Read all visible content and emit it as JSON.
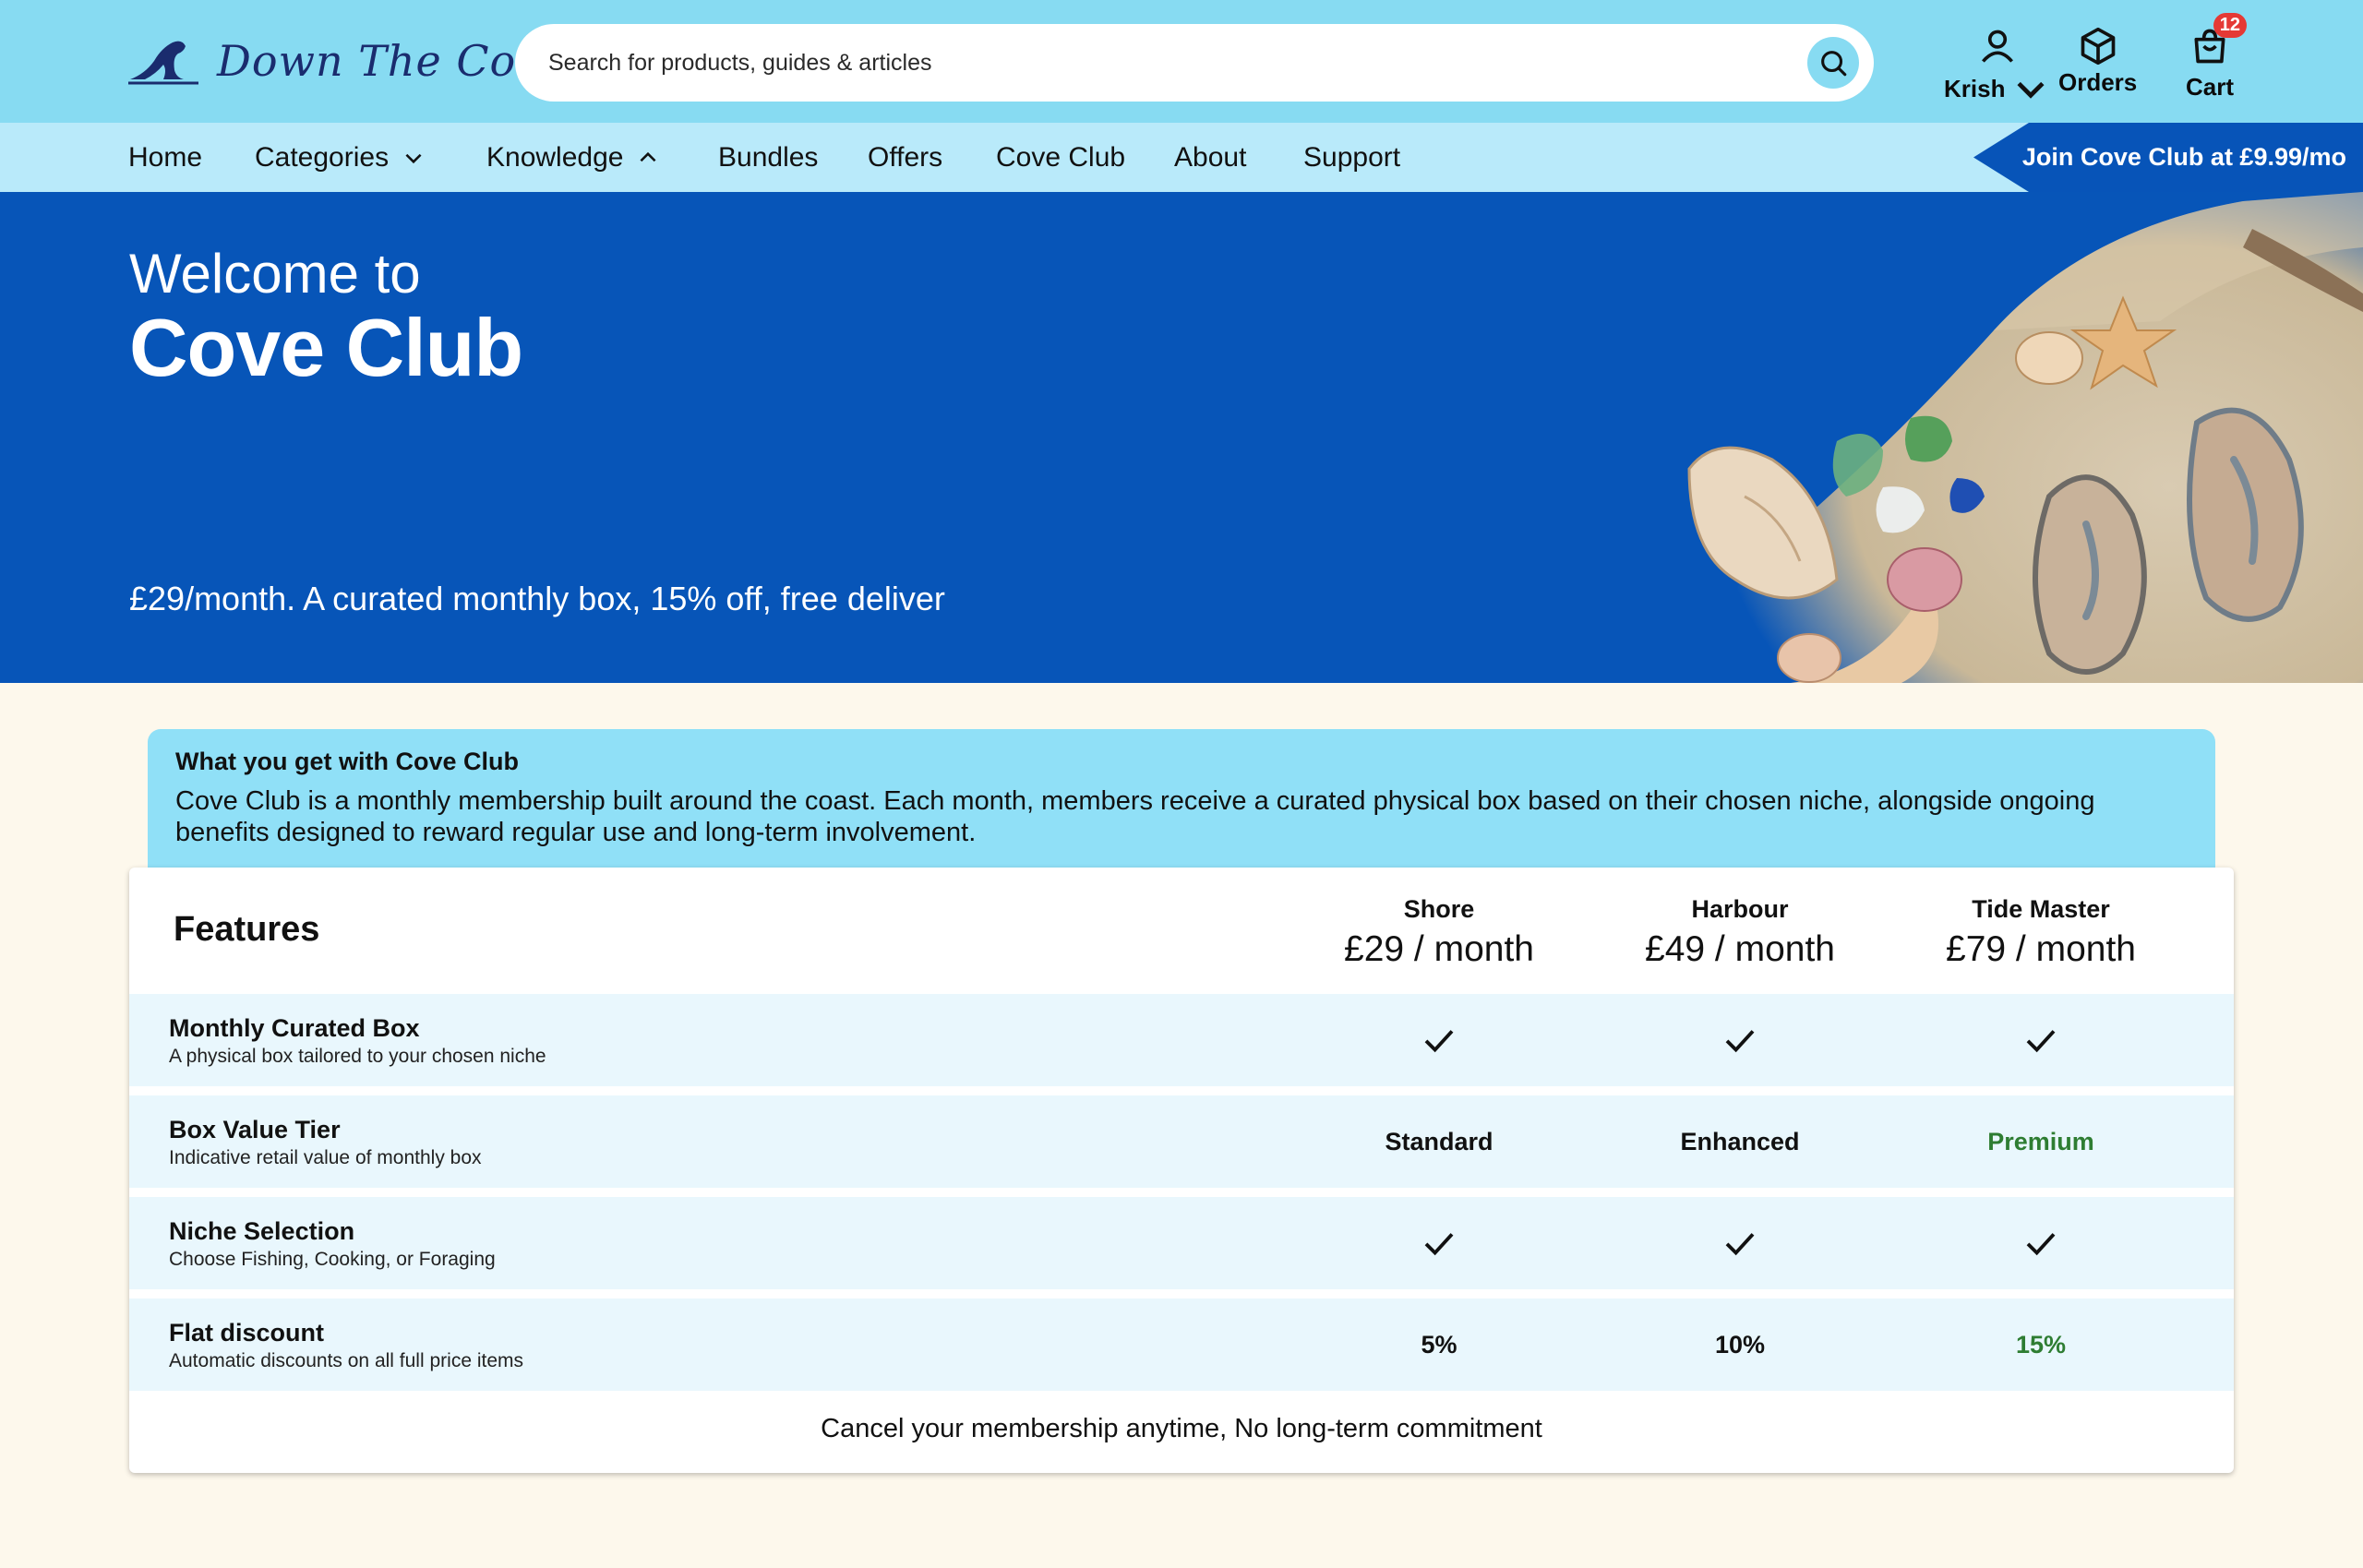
{
  "brand": {
    "name": "Down The Cove"
  },
  "search": {
    "placeholder": "Search for products, guides & articles"
  },
  "header": {
    "account_label": "Krish",
    "orders_label": "Orders",
    "cart_label": "Cart",
    "cart_count": "12"
  },
  "nav": {
    "items": [
      {
        "label": "Home"
      },
      {
        "label": "Categories"
      },
      {
        "label": "Knowledge"
      },
      {
        "label": "Bundles"
      },
      {
        "label": "Offers"
      },
      {
        "label": "Cove Club"
      },
      {
        "label": "About"
      },
      {
        "label": "Support"
      }
    ],
    "join_banner": "Join Cove Club at £9.99/mo"
  },
  "hero": {
    "pre_title": "Welcome to",
    "title": "Cove Club",
    "subtitle": "£29/month. A curated monthly box, 15% off, free deliver"
  },
  "info": {
    "title": "What you get with Cove Club",
    "body": "Cove Club is a monthly membership built around the coast. Each month, members receive a curated physical box based on their chosen niche, alongside ongoing benefits designed to reward regular use and long-term involvement."
  },
  "table": {
    "features_heading": "Features",
    "plans": [
      {
        "name": "Shore",
        "price": "£29 / month"
      },
      {
        "name": "Harbour",
        "price": "£49 / month"
      },
      {
        "name": "Tide Master",
        "price": "£79 / month"
      }
    ],
    "rows": [
      {
        "title": "Monthly Curated Box",
        "desc": "A physical box tailored to your chosen niche",
        "values": [
          "check",
          "check",
          "check"
        ]
      },
      {
        "title": "Box Value Tier",
        "desc": "Indicative retail value of monthly box",
        "values": [
          "Standard",
          "Enhanced",
          "Premium"
        ]
      },
      {
        "title": "Niche Selection",
        "desc": "Choose Fishing, Cooking, or Foraging",
        "values": [
          "check",
          "check",
          "check"
        ]
      },
      {
        "title": "Flat discount",
        "desc": "Automatic discounts on all full price items",
        "values": [
          "5%",
          "10%",
          "15%"
        ]
      }
    ],
    "footer": "Cancel your membership anytime, No long-term commitment"
  },
  "colors": {
    "header_bg": "#87dbf2",
    "nav_bg": "#b9eafa",
    "hero_bg": "#0755b8",
    "info_bg": "#90e0f7",
    "row_bg": "#e9f7fd",
    "accent_green": "#2e7d32",
    "page_bg": "#fdf8ec"
  }
}
